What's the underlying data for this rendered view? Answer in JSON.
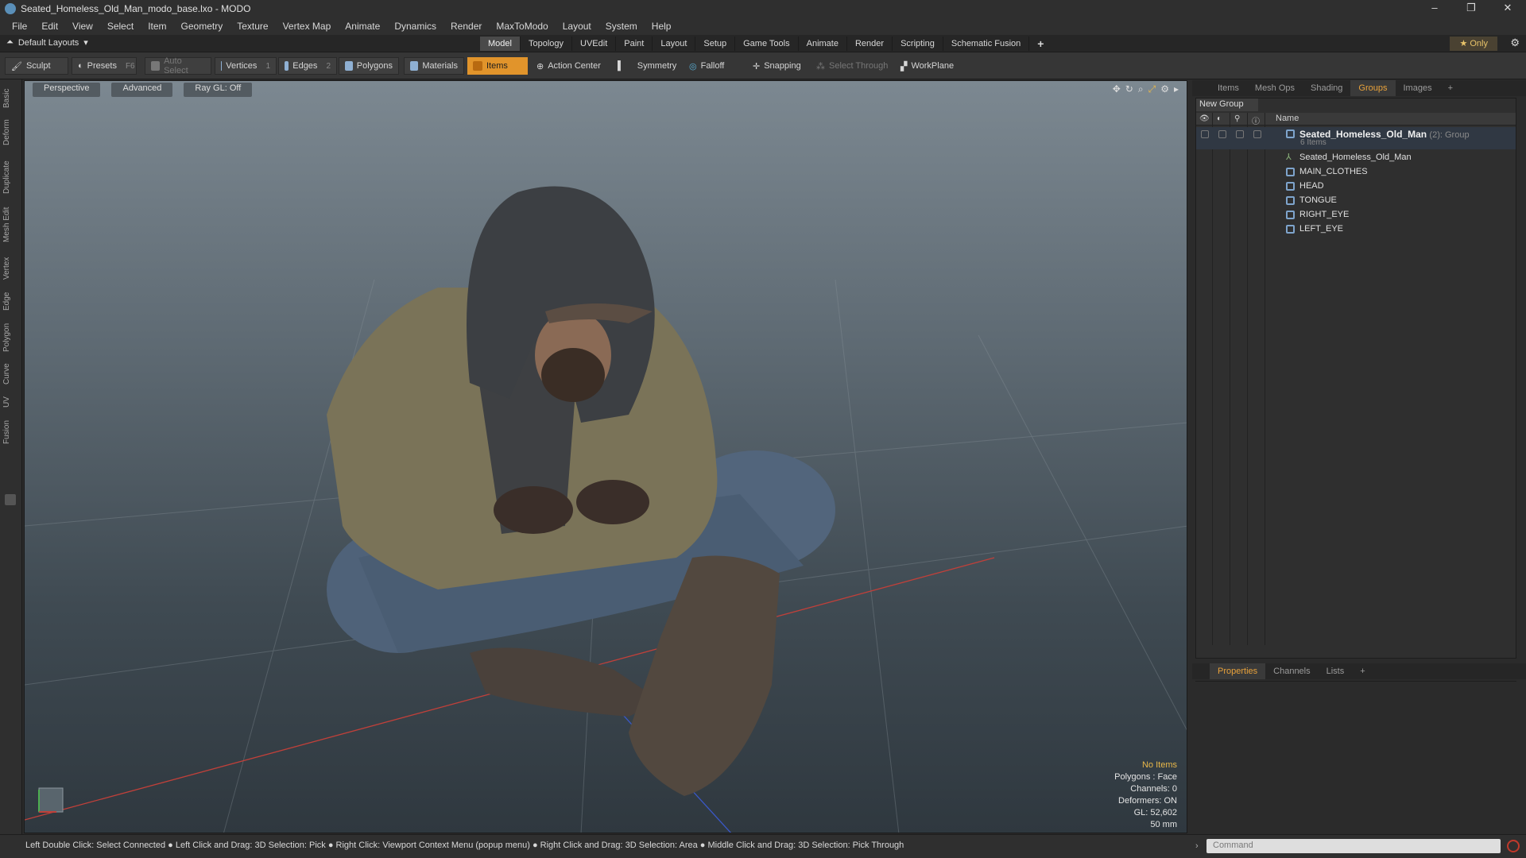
{
  "window": {
    "title": "Seated_Homeless_Old_Man_modo_base.lxo - MODO",
    "controls": [
      "–",
      "❐",
      "✕"
    ]
  },
  "menu": [
    "File",
    "Edit",
    "View",
    "Select",
    "Item",
    "Geometry",
    "Texture",
    "Vertex Map",
    "Animate",
    "Dynamics",
    "Render",
    "MaxToModo",
    "Layout",
    "System",
    "Help"
  ],
  "layout_bar": {
    "layout_name": "Default Layouts",
    "tabs": [
      "Model",
      "Topology",
      "UVEdit",
      "Paint",
      "Layout",
      "Setup",
      "Game Tools",
      "Animate",
      "Render",
      "Scripting",
      "Schematic Fusion"
    ],
    "active_tab": "Model",
    "add": "+",
    "only": "Only"
  },
  "toolbar": {
    "sculpt": "Sculpt",
    "presets": "Presets",
    "presets_key": "F6",
    "auto_select": "Auto Select",
    "vertices": "Vertices",
    "vertices_n": "1",
    "edges": "Edges",
    "edges_n": "2",
    "polygons": "Polygons",
    "materials": "Materials",
    "items": "Items",
    "action_center": "Action Center",
    "symmetry": "Symmetry",
    "falloff": "Falloff",
    "snapping": "Snapping",
    "select_through": "Select Through",
    "workplane": "WorkPlane"
  },
  "left_tabs": [
    "Basic",
    "Deform",
    "Duplicate",
    "Mesh Edit",
    "Vertex",
    "Edge",
    "Polygon",
    "Curve",
    "UV",
    "Fusion"
  ],
  "viewport": {
    "buttons": [
      "Perspective",
      "Advanced",
      "Ray GL: Off"
    ],
    "info": {
      "no_items": "No Items",
      "polygons": "Polygons : Face",
      "channels": "Channels: 0",
      "deformers": "Deformers: ON",
      "gl": "GL: 52,602",
      "lens": "50 mm"
    }
  },
  "right_panel": {
    "tabs": [
      "Items",
      "Mesh Ops",
      "Shading",
      "Groups",
      "Images",
      "+"
    ],
    "active_tab": "Groups",
    "new_group": "New Group",
    "column_name": "Name",
    "group": {
      "name": "Seated_Homeless_Old_Man",
      "count": "(2)",
      "type": ": Group",
      "sub": "6 Items"
    },
    "children": [
      "Seated_Homeless_Old_Man",
      "MAIN_CLOTHES",
      "HEAD",
      "TONGUE",
      "RIGHT_EYE",
      "LEFT_EYE"
    ],
    "lower_tabs": [
      "Properties",
      "Channels",
      "Lists",
      "+"
    ],
    "lower_active": "Properties"
  },
  "status": {
    "hint": "Left Double Click: Select Connected ● Left Click and Drag: 3D Selection: Pick ● Right Click: Viewport Context Menu (popup menu) ● Right Click and Drag: 3D Selection: Area ● Middle Click and Drag: 3D Selection: Pick Through",
    "command_placeholder": "Command"
  }
}
